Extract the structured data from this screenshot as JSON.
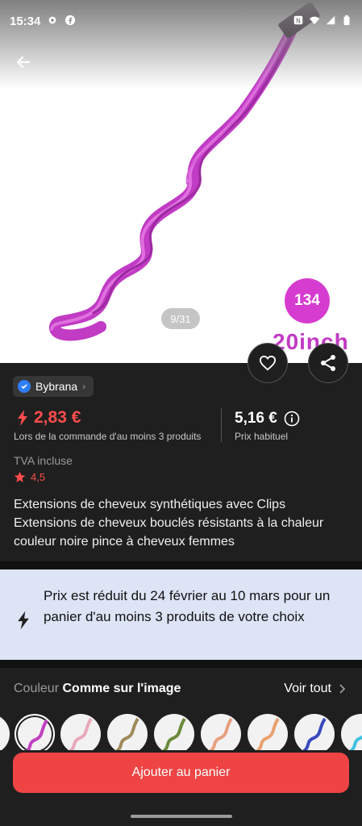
{
  "status": {
    "time": "15:34"
  },
  "gallery": {
    "badge": "134",
    "image_caption": "20inch",
    "pager": "9/31"
  },
  "seller": {
    "name": "Bybrana"
  },
  "price": {
    "sale": "2,83 €",
    "sale_note": "Lors de la commande d'au moins 3 produits",
    "regular": "5,16 €",
    "regular_note": "Prix habituel",
    "vat": "TVA incluse",
    "rating": "4,5"
  },
  "product": {
    "title": "Extensions de cheveux synthétiques avec Clips Extensions de cheveux bouclés résistants à la chaleur couleur noire pince à cheveux femmes"
  },
  "promo": {
    "text": "Prix est réduit du 24 février au 10 mars pour un panier d'au moins 3 produits de votre choix"
  },
  "variants": {
    "label": "Couleur",
    "selected": "Comme sur l'image",
    "see_all": "Voir tout",
    "swatch_colors": [
      "#c040c0",
      "#e9a8b8",
      "#a08a5a",
      "#6a8a3a",
      "#e8a080",
      "#e8a070",
      "#3a4ac0",
      "#40c0e0"
    ]
  },
  "cart": {
    "label": "Ajouter au panier"
  },
  "colors": {
    "accent": "#ef4444",
    "price_red": "#ff4d4d",
    "promo_bg": "#dde4f6",
    "hair": "#c13bc4"
  }
}
